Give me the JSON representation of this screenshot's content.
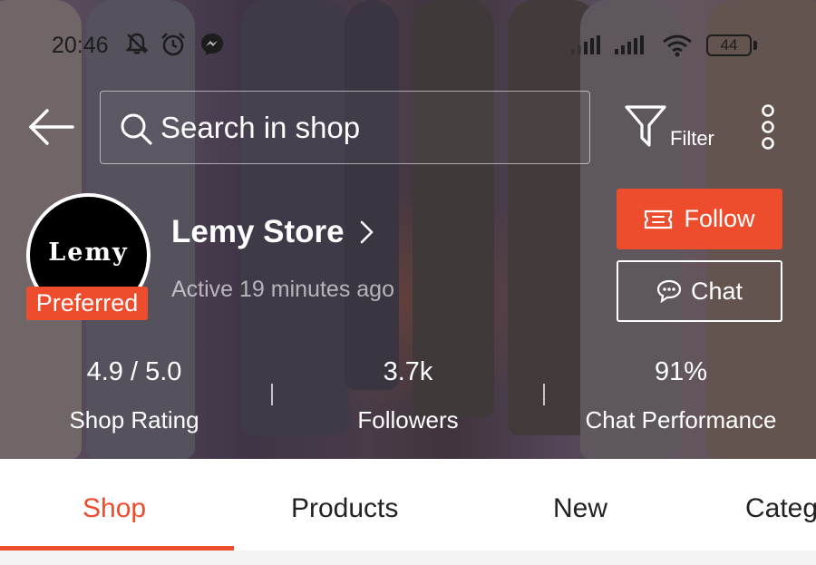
{
  "status_bar": {
    "time": "20:46",
    "icons": [
      "alarm-off-icon",
      "alarm-clock-icon",
      "messenger-icon",
      "signal-icon",
      "signal-icon",
      "wifi-icon"
    ],
    "battery": "44"
  },
  "header": {
    "search_placeholder": "Search in shop",
    "filter_label": "Filter"
  },
  "shop": {
    "logo_text": "Lemy",
    "badge": "Preferred",
    "name": "Lemy Store",
    "active_status": "Active 19 minutes ago",
    "follow_label": "Follow",
    "chat_label": "Chat"
  },
  "stats": [
    {
      "value": "4.9 / 5.0",
      "label": "Shop Rating"
    },
    {
      "value": "3.7k",
      "label": "Followers"
    },
    {
      "value": "91%",
      "label": "Chat Performance"
    }
  ],
  "tabs": [
    {
      "label": "Shop",
      "active": true
    },
    {
      "label": "Products",
      "active": false
    },
    {
      "label": "New",
      "active": false
    },
    {
      "label": "Categ",
      "active": false
    }
  ],
  "colors": {
    "accent": "#ee4d2d",
    "tab_text": "#222222",
    "white": "#ffffff"
  }
}
